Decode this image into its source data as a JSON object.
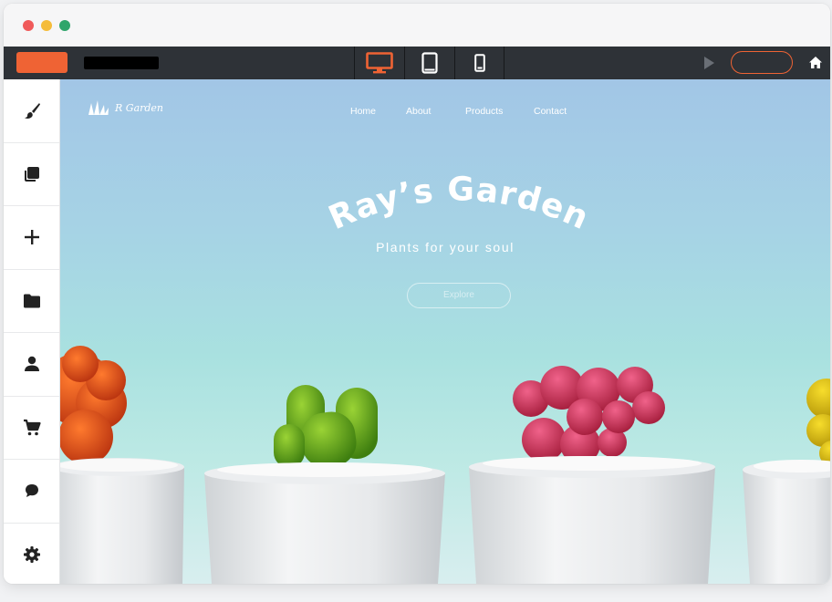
{
  "editor": {
    "window_controls": [
      "close",
      "minimize",
      "maximize"
    ],
    "toolbar": {
      "accent_color": "#ef6334",
      "devices": [
        {
          "name": "desktop-icon",
          "active": true
        },
        {
          "name": "tablet-icon",
          "active": false
        },
        {
          "name": "mobile-icon",
          "active": false
        }
      ]
    },
    "sidebar": {
      "items": [
        {
          "icon": "brush-icon"
        },
        {
          "icon": "pages-icon"
        },
        {
          "icon": "add-icon"
        },
        {
          "icon": "folder-icon"
        },
        {
          "icon": "user-icon"
        },
        {
          "icon": "cart-icon"
        },
        {
          "icon": "chat-icon"
        },
        {
          "icon": "settings-icon"
        }
      ]
    }
  },
  "site": {
    "logo_text": "R Garden",
    "nav": [
      {
        "label": "Home"
      },
      {
        "label": "About"
      },
      {
        "label": "Products"
      },
      {
        "label": "Contact"
      }
    ],
    "hero": {
      "title": "Ray’s Garden",
      "subtitle": "Plants for your soul",
      "button_label": "Explore"
    },
    "plants": [
      {
        "color": "#e0511c",
        "kind": "orange-cactus"
      },
      {
        "color": "#5ea21d",
        "kind": "green-cactus"
      },
      {
        "color": "#d6395e",
        "kind": "pink-cactus"
      },
      {
        "color": "#e3c31a",
        "kind": "yellow-cactus"
      }
    ]
  }
}
